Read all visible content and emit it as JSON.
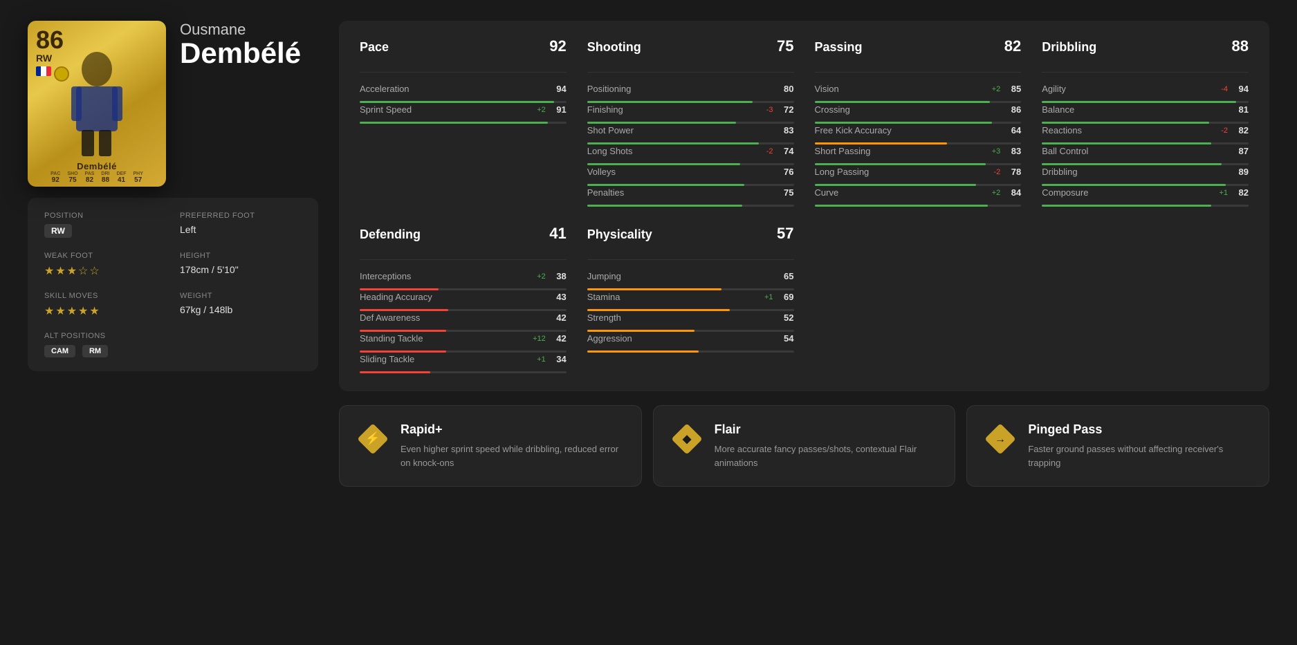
{
  "player": {
    "first_name": "Ousmane",
    "last_name": "Dembélé",
    "card_name": "Dembélé",
    "rating": "86",
    "position": "RW",
    "preferred_foot": "Left",
    "height": "178cm / 5'10\"",
    "weight": "67kg / 148lb",
    "weak_foot_stars": 3,
    "skill_moves_stars": 5,
    "alt_positions": [
      "CAM",
      "RM"
    ],
    "card_stats": {
      "pac": "92",
      "sho": "75",
      "pas": "82",
      "dri": "88",
      "def": "41",
      "phy": "57"
    }
  },
  "labels": {
    "position": "Position",
    "weak_foot": "Weak Foot",
    "skill_moves": "Skill Moves",
    "preferred_foot": "Preferred Foot",
    "height": "Height",
    "weight": "Weight",
    "alt_positions": "Alt Positions"
  },
  "categories": {
    "pace": {
      "name": "Pace",
      "value": 92,
      "stats": [
        {
          "name": "Acceleration",
          "value": 94,
          "modifier": "",
          "bar_pct": 94
        },
        {
          "name": "Sprint Speed",
          "value": 91,
          "modifier": "+2",
          "bar_pct": 91
        }
      ]
    },
    "shooting": {
      "name": "Shooting",
      "value": 75,
      "stats": [
        {
          "name": "Positioning",
          "value": 80,
          "modifier": "",
          "bar_pct": 80
        },
        {
          "name": "Finishing",
          "value": 72,
          "modifier": "-3",
          "bar_pct": 72
        },
        {
          "name": "Shot Power",
          "value": 83,
          "modifier": "",
          "bar_pct": 83
        },
        {
          "name": "Long Shots",
          "value": 74,
          "modifier": "-2",
          "bar_pct": 74
        },
        {
          "name": "Volleys",
          "value": 76,
          "modifier": "",
          "bar_pct": 76
        },
        {
          "name": "Penalties",
          "value": 75,
          "modifier": "",
          "bar_pct": 75
        }
      ]
    },
    "passing": {
      "name": "Passing",
      "value": 82,
      "stats": [
        {
          "name": "Vision",
          "value": 85,
          "modifier": "+2",
          "bar_pct": 85
        },
        {
          "name": "Crossing",
          "value": 86,
          "modifier": "",
          "bar_pct": 86
        },
        {
          "name": "Free Kick Accuracy",
          "value": 64,
          "modifier": "",
          "bar_pct": 64
        },
        {
          "name": "Short Passing",
          "value": 83,
          "modifier": "+3",
          "bar_pct": 83
        },
        {
          "name": "Long Passing",
          "value": 78,
          "modifier": "-2",
          "bar_pct": 78
        },
        {
          "name": "Curve",
          "value": 84,
          "modifier": "+2",
          "bar_pct": 84
        }
      ]
    },
    "dribbling": {
      "name": "Dribbling",
      "value": 88,
      "stats": [
        {
          "name": "Agility",
          "value": 94,
          "modifier": "-4",
          "bar_pct": 94
        },
        {
          "name": "Balance",
          "value": 81,
          "modifier": "",
          "bar_pct": 81
        },
        {
          "name": "Reactions",
          "value": 82,
          "modifier": "-2",
          "bar_pct": 82
        },
        {
          "name": "Ball Control",
          "value": 87,
          "modifier": "",
          "bar_pct": 87
        },
        {
          "name": "Dribbling",
          "value": 89,
          "modifier": "",
          "bar_pct": 89
        },
        {
          "name": "Composure",
          "value": 82,
          "modifier": "+1",
          "bar_pct": 82
        }
      ]
    },
    "defending": {
      "name": "Defending",
      "value": 41,
      "stats": [
        {
          "name": "Interceptions",
          "value": 38,
          "modifier": "+2",
          "bar_pct": 38
        },
        {
          "name": "Heading Accuracy",
          "value": 43,
          "modifier": "",
          "bar_pct": 43
        },
        {
          "name": "Def Awareness",
          "value": 42,
          "modifier": "",
          "bar_pct": 42
        },
        {
          "name": "Standing Tackle",
          "value": 42,
          "modifier": "+12",
          "bar_pct": 42
        },
        {
          "name": "Sliding Tackle",
          "value": 34,
          "modifier": "+1",
          "bar_pct": 34
        }
      ]
    },
    "physicality": {
      "name": "Physicality",
      "value": 57,
      "stats": [
        {
          "name": "Jumping",
          "value": 65,
          "modifier": "",
          "bar_pct": 65
        },
        {
          "name": "Stamina",
          "value": 69,
          "modifier": "+1",
          "bar_pct": 69
        },
        {
          "name": "Strength",
          "value": 52,
          "modifier": "",
          "bar_pct": 52
        },
        {
          "name": "Aggression",
          "value": 54,
          "modifier": "",
          "bar_pct": 54
        }
      ]
    }
  },
  "traits": [
    {
      "name": "Rapid+",
      "desc": "Even higher sprint speed while dribbling, reduced error on knock-ons",
      "icon": "⚡"
    },
    {
      "name": "Flair",
      "desc": "More accurate fancy passes/shots, contextual Flair animations",
      "icon": "◆"
    },
    {
      "name": "Pinged Pass",
      "desc": "Faster ground passes without affecting receiver's trapping",
      "icon": "→"
    }
  ]
}
